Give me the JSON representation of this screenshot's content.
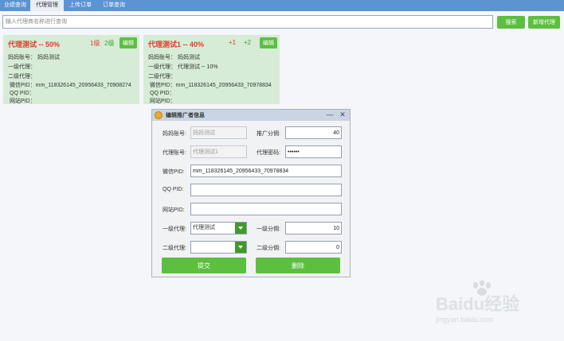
{
  "tabs": [
    "业绩查询",
    "代理管理",
    "上传订单",
    "订单查询"
  ],
  "search": {
    "placeholder": "输入代理商名称进行查询",
    "button": "搜索",
    "add_button": "新增代理"
  },
  "cards": [
    {
      "title": "代理测试 -- 50%",
      "badge1": "1级",
      "badge2": "2级",
      "edit": "编辑",
      "rows": [
        "妈妈账号： 妈妈测试",
        "一级代理：",
        "二级代理：",
        "微信PID：mm_118326145_20956433_70908274",
        "QQ PID：",
        "网站PID："
      ]
    },
    {
      "title": "代理测试1 -- 40%",
      "badge1": "+1",
      "badge2": "+2",
      "edit": "编辑",
      "rows": [
        "妈妈账号： 妈妈测试",
        "一级代理： 代理测试  -- 10%",
        "二级代理：",
        "微信PID：mm_118326145_20956433_70978834",
        "QQ PID：",
        "网站PID："
      ]
    }
  ],
  "dialog": {
    "title": "编辑推广者信息",
    "minimize": "—",
    "close": "✕",
    "labels": {
      "mama": "妈妈账号:",
      "commission": "推广分佣:",
      "agent_account": "代理账号:",
      "agent_password": "代理密码:",
      "wechat": "微信PID:",
      "qq": "QQ PID:",
      "site": "网站PID:",
      "level1": "一级代理:",
      "level1_commission": "一级分佣:",
      "level2": "二级代理:",
      "level2_commission": "二级分佣:"
    },
    "values": {
      "mama": "妈妈测试",
      "commission": "40",
      "agent_account": "代理测试1",
      "agent_password": "••••••",
      "wechat": "mm_118326145_20956433_70978834",
      "qq": "",
      "site": "",
      "level1": "代理测试",
      "level1_commission": "10",
      "level2": "",
      "level2_commission": "0"
    },
    "submit": "提交",
    "delete": "删除"
  },
  "watermark": {
    "line1": "Baidu经验",
    "line2": "jingyan.baidu.com"
  },
  "colors": {
    "tab_bar": "#5b93d3",
    "green": "#5cbf3f",
    "card_bg": "#d6ecd6",
    "card_title": "#e13b2b"
  }
}
